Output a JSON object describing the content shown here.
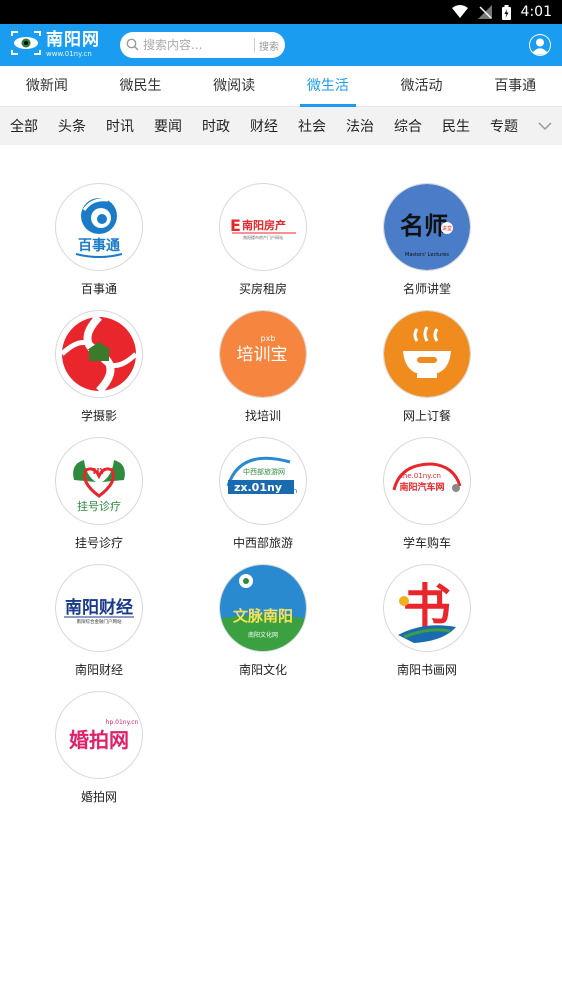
{
  "status": {
    "time": "4:01"
  },
  "header": {
    "logo_title": "南阳网",
    "logo_url": "www.01ny.cn",
    "search_placeholder": "搜索内容...",
    "search_button": "搜索"
  },
  "main_tabs": [
    {
      "label": "微新闻"
    },
    {
      "label": "微民生"
    },
    {
      "label": "微阅读"
    },
    {
      "label": "微生活",
      "active": true
    },
    {
      "label": "微活动"
    },
    {
      "label": "百事通"
    }
  ],
  "sub_tabs": [
    "全部",
    "头条",
    "时讯",
    "要闻",
    "时政",
    "财经",
    "社会",
    "法治",
    "综合",
    "民生",
    "专题"
  ],
  "services": [
    {
      "label": "百事通",
      "logo_text": "百事通"
    },
    {
      "label": "买房租房",
      "logo_text": "南阳房产",
      "logo_sub": "南阳楼市房产门户网站"
    },
    {
      "label": "名师讲堂",
      "logo_text": "名师",
      "logo_sub": "Masters' Lectures",
      "logo_badge": "讲堂"
    },
    {
      "label": "学摄影"
    },
    {
      "label": "找培训",
      "logo_text": "培训宝",
      "logo_sub": "pxb"
    },
    {
      "label": "网上订餐"
    },
    {
      "label": "挂号诊疗",
      "logo_text": "挂号诊疗",
      "logo_sub": "NY"
    },
    {
      "label": "中西部旅游",
      "logo_text": "zx.01ny",
      "logo_sub": "中西部旅游网",
      "logo_badge": ".cn"
    },
    {
      "label": "学车购车",
      "logo_text": "南阳汽车网",
      "logo_sub": "che.01ny.cn"
    },
    {
      "label": "南阳财经",
      "logo_text": "南阳财经",
      "logo_sub": "南阳综合金融门户网站"
    },
    {
      "label": "南阳文化",
      "logo_text": "文脉南阳",
      "logo_sub": "南阳文化网"
    },
    {
      "label": "南阳书画网",
      "logo_text": "书"
    },
    {
      "label": "婚拍网",
      "logo_text": "婚拍网",
      "logo_sub": "hp.01ny.cn"
    }
  ],
  "colors": {
    "brand_blue": "#1a9df0",
    "red": "#e8262b",
    "orange": "#f08c1e"
  }
}
